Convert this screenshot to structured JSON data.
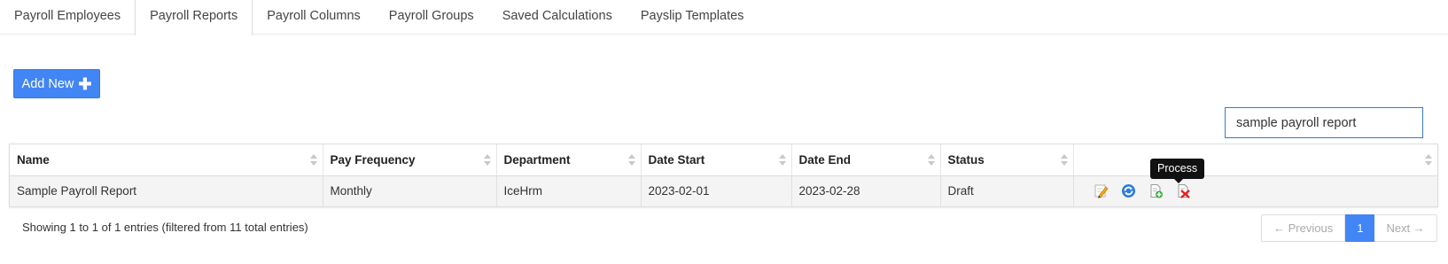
{
  "tabs": [
    {
      "label": "Payroll Employees",
      "active": false
    },
    {
      "label": "Payroll Reports",
      "active": true
    },
    {
      "label": "Payroll Columns",
      "active": false
    },
    {
      "label": "Payroll Groups",
      "active": false
    },
    {
      "label": "Saved Calculations",
      "active": false
    },
    {
      "label": "Payslip Templates",
      "active": false
    }
  ],
  "toolbar": {
    "add_label": "Add New",
    "add_icon": "plus-icon"
  },
  "search": {
    "value": "sample payroll report"
  },
  "table": {
    "headers": [
      "Name",
      "Pay Frequency",
      "Department",
      "Date Start",
      "Date End",
      "Status",
      ""
    ],
    "rows": [
      {
        "name": "Sample Payroll Report",
        "pay_frequency": "Monthly",
        "department": "IceHrm",
        "date_start": "2023-02-01",
        "date_end": "2023-02-28",
        "status": "Draft"
      }
    ],
    "row_actions": [
      "edit-icon",
      "process-icon",
      "copy-icon",
      "delete-icon"
    ]
  },
  "tooltip": {
    "text": "Process"
  },
  "footer": {
    "info": "Showing 1 to 1 of 1 entries (filtered from 11 total entries)"
  },
  "pagination": {
    "prev": "← Previous",
    "current": "1",
    "next": "Next →"
  },
  "colors": {
    "accent": "#4285f4",
    "tooltip_bg": "#111111",
    "row_bg": "#f4f4f4"
  }
}
